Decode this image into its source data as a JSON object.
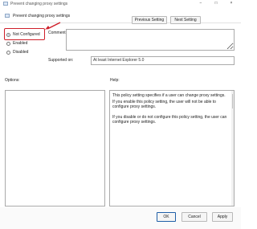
{
  "window": {
    "title": "Prevent changing proxy settings",
    "minimize_icon": "minimize-icon",
    "maximize_icon": "maximize-icon",
    "close_icon": "close-icon"
  },
  "header": {
    "policy_name": "Prevent changing proxy settings",
    "previous_label": "Previous Setting",
    "next_label": "Next Setting"
  },
  "state": {
    "options": [
      {
        "label": "Not Configured",
        "selected": true
      },
      {
        "label": "Enabled",
        "selected": false
      },
      {
        "label": "Disabled",
        "selected": false
      }
    ]
  },
  "comment": {
    "label": "Comment:",
    "value": ""
  },
  "supported": {
    "label": "Supported on:",
    "value": "At least Internet Explorer 5.0"
  },
  "panels": {
    "options_label": "Options:",
    "help_label": "Help:",
    "help_paragraphs": [
      "This policy setting specifies if a user can change proxy settings.",
      "If you enable this policy setting, the user will not be able to configure proxy settings.",
      "If you disable or do not configure this policy setting, the user can configure proxy settings."
    ]
  },
  "footer": {
    "ok_label": "OK",
    "cancel_label": "Cancel",
    "apply_label": "Apply"
  },
  "colors": {
    "highlight": "#cf1f2a",
    "selected_radio": "#1f5fa8"
  }
}
